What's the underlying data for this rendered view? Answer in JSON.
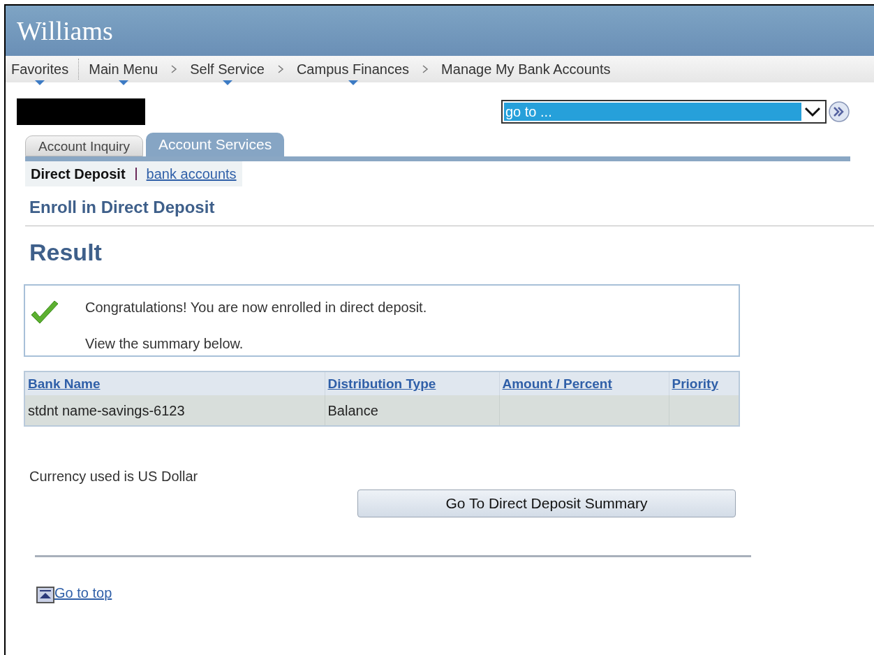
{
  "header": {
    "title": "Williams"
  },
  "nav": [
    {
      "label": "Favorites",
      "has_menu": true
    },
    {
      "label": "Main Menu",
      "has_menu": true
    },
    {
      "label": "Self Service",
      "has_menu": true
    },
    {
      "label": "Campus Finances",
      "has_menu": true
    },
    {
      "label": "Manage My Bank Accounts",
      "has_menu": false
    }
  ],
  "goto": {
    "value": "go to ..."
  },
  "tabs": [
    {
      "label": "Account Inquiry",
      "selected": false
    },
    {
      "label": "Account Services",
      "selected": true
    }
  ],
  "subnav": [
    {
      "label": "Direct Deposit",
      "selected": true
    },
    {
      "label": "bank accounts",
      "selected": false
    }
  ],
  "page_title": "Enroll in Direct Deposit",
  "section_title": "Result",
  "message": {
    "lines": [
      "Congratulations! You are now enrolled in direct deposit.",
      "View the summary below."
    ]
  },
  "table": {
    "columns": [
      "Bank Name",
      "Distribution Type",
      "Amount / Percent",
      "Priority"
    ],
    "rows": [
      [
        "stdnt name-savings-6123",
        "Balance",
        "",
        ""
      ]
    ]
  },
  "currency_note": "Currency used is US Dollar",
  "summary_button": "Go To Direct Deposit Summary",
  "top_link": "Go to top"
}
